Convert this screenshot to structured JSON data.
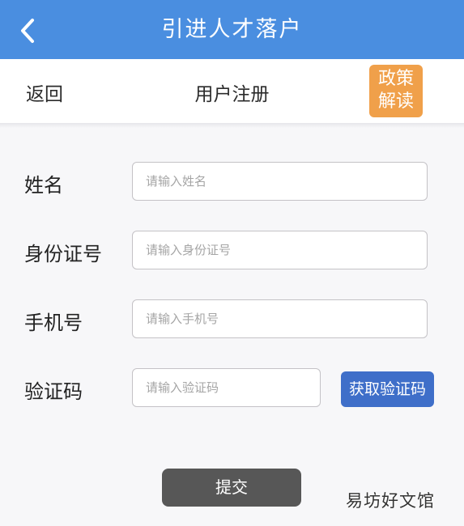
{
  "header": {
    "title": "引进人才落户",
    "back_icon": "chevron-left-icon"
  },
  "subbar": {
    "return_label": "返回",
    "title": "用户注册",
    "policy_line1": "政策",
    "policy_line2": "解读"
  },
  "form": {
    "name_label": "姓名",
    "name_placeholder": "请输入姓名",
    "id_label": "身份证号",
    "id_placeholder": "请输入身份证号",
    "phone_label": "手机号",
    "phone_placeholder": "请输入手机号",
    "code_label": "验证码",
    "code_placeholder": "请输入验证码",
    "get_code_label": "获取验证码",
    "submit_label": "提交"
  },
  "watermark": "易坊好文馆",
  "colors": {
    "header": "#4a8ee0",
    "policy_button": "#f0a04a",
    "code_button": "#3f6fc9",
    "submit_button": "#575757"
  }
}
